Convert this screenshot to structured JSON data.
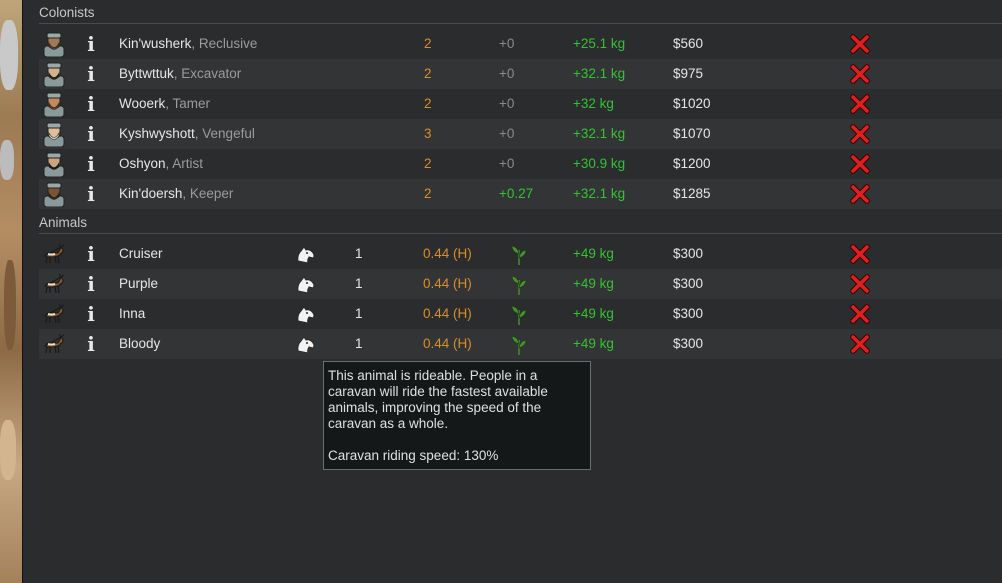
{
  "sections": {
    "colonists": "Colonists",
    "animals": "Animals"
  },
  "colonists": [
    {
      "name": "Kin'wusherk",
      "title": ", Reclusive",
      "count": "2",
      "carry": "+0",
      "mass": "+25.1 kg",
      "value": "$560",
      "beard": "#5a3b22",
      "skin": "#a07a55"
    },
    {
      "name": "Byttwttuk",
      "title": ", Excavator",
      "count": "2",
      "carry": "+0",
      "mass": "+32.1 kg",
      "value": "$975",
      "beard": "#2a1d12",
      "skin": "#d2b48c"
    },
    {
      "name": "Wooerk",
      "title": ", Tamer",
      "count": "2",
      "carry": "+0",
      "mass": "+32 kg",
      "value": "$1020",
      "beard": "#6b3e1e",
      "skin": "#c48a5c"
    },
    {
      "name": "Kyshwyshott",
      "title": ", Vengeful",
      "count": "3",
      "carry": "+0",
      "mass": "+32.1 kg",
      "value": "$1070",
      "beard": "#cfcfcf",
      "skin": "#e0c09a"
    },
    {
      "name": "Oshyon",
      "title": ", Artist",
      "count": "2",
      "carry": "+0",
      "mass": "+30.9 kg",
      "value": "$1200",
      "beard": "#1e1610",
      "skin": "#caa680"
    },
    {
      "name": "Kin'doersh",
      "title": ", Keeper",
      "count": "2",
      "carry": "+0.27",
      "mass": "+32.1 kg",
      "value": "$1285",
      "beard": "#3a2616",
      "skin": "#7a5436"
    }
  ],
  "animals": [
    {
      "name": "Cruiser",
      "packs": "1",
      "speed": "0.44 (H)",
      "mass": "+49 kg",
      "value": "$300"
    },
    {
      "name": "Purple",
      "packs": "1",
      "speed": "0.44 (H)",
      "mass": "+49 kg",
      "value": "$300"
    },
    {
      "name": "Inna",
      "packs": "1",
      "speed": "0.44 (H)",
      "mass": "+49 kg",
      "value": "$300"
    },
    {
      "name": "Bloody",
      "packs": "1",
      "speed": "0.44 (H)",
      "mass": "+49 kg",
      "value": "$300"
    }
  ],
  "icons": {
    "info": "i",
    "remove": "red-x-icon",
    "ride": "horse-head-icon",
    "diet": "plant-icon",
    "animal": "deer-icon",
    "colonist": "colonist-portrait-icon"
  },
  "colors": {
    "orange": "#d98e2a",
    "green": "#34c234",
    "red": "#e02020"
  },
  "tooltip": {
    "body": "This animal is rideable. People in a caravan will ride the fastest available animals, improving the speed of the caravan as a whole.",
    "footer": "Caravan riding speed: 130%"
  }
}
